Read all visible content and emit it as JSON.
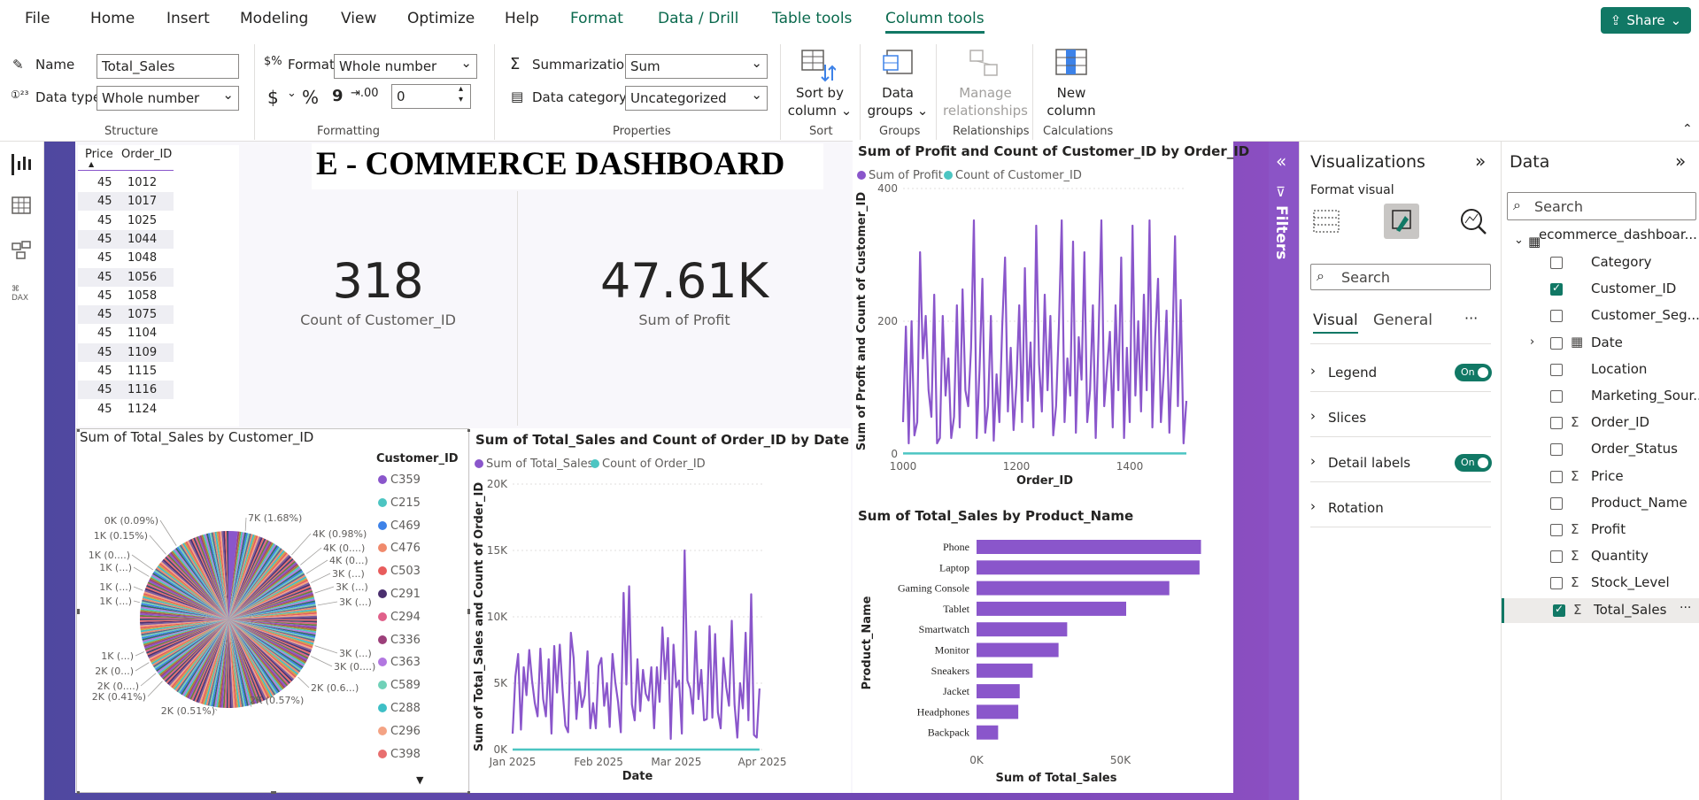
{
  "menu": {
    "items": [
      "File",
      "Home",
      "Insert",
      "Modeling",
      "View",
      "Optimize",
      "Help"
    ],
    "context_items": [
      "Format",
      "Data / Drill",
      "Table tools",
      "Column tools"
    ],
    "active": "Column tools",
    "share": "Share"
  },
  "ribbon": {
    "structure": {
      "name_label": "Name",
      "name_value": "Total_Sales",
      "datatype_label": "Data type",
      "datatype_value": "Whole number",
      "group": "Structure"
    },
    "formatting": {
      "format_label": "Format",
      "format_value": "Whole number",
      "currency": "$",
      "percent": "%",
      "comma": "9",
      "decimals_value": "0",
      "group": "Formatting"
    },
    "properties": {
      "summarization_label": "Summarization",
      "summarization_value": "Sum",
      "category_label": "Data category",
      "category_value": "Uncategorized",
      "group": "Properties"
    },
    "sort": {
      "label1": "Sort by",
      "label2": "column",
      "group": "Sort"
    },
    "groups": {
      "label1": "Data",
      "label2": "groups",
      "group": "Groups"
    },
    "relationships": {
      "label1": "Manage",
      "label2": "relationships",
      "group": "Relationships"
    },
    "calculations": {
      "label1": "New",
      "label2": "column",
      "group": "Calculations"
    }
  },
  "dashboard": {
    "title": "E - COMMERCE DASHBOARD",
    "kpi1": {
      "value": "318",
      "label": "Count of Customer_ID"
    },
    "kpi2": {
      "value": "47.61K",
      "label": "Sum of Profit"
    }
  },
  "table": {
    "headers": [
      "Price",
      "Order_ID"
    ],
    "rows": [
      [
        "45",
        "1012"
      ],
      [
        "45",
        "1017"
      ],
      [
        "45",
        "1025"
      ],
      [
        "45",
        "1044"
      ],
      [
        "45",
        "1048"
      ],
      [
        "45",
        "1056"
      ],
      [
        "45",
        "1058"
      ],
      [
        "45",
        "1075"
      ],
      [
        "45",
        "1104"
      ],
      [
        "45",
        "1109"
      ],
      [
        "45",
        "1115"
      ],
      [
        "45",
        "1116"
      ],
      [
        "45",
        "1124"
      ]
    ]
  },
  "pie_visual": {
    "title": "Sum of Total_Sales by Customer_ID",
    "legend_title": "Customer_ID",
    "legend": [
      {
        "name": "C359",
        "color": "#8a56cb"
      },
      {
        "name": "C215",
        "color": "#4cc5c2"
      },
      {
        "name": "C469",
        "color": "#3d82e8"
      },
      {
        "name": "C476",
        "color": "#f08a6c"
      },
      {
        "name": "C503",
        "color": "#e85c5c"
      },
      {
        "name": "C291",
        "color": "#4a2f6e"
      },
      {
        "name": "C294",
        "color": "#e0608a"
      },
      {
        "name": "C336",
        "color": "#9c3f7a"
      },
      {
        "name": "C363",
        "color": "#b277e0"
      },
      {
        "name": "C589",
        "color": "#70d1b8"
      },
      {
        "name": "C288",
        "color": "#3ebfc6"
      },
      {
        "name": "C296",
        "color": "#f4a384"
      },
      {
        "name": "C398",
        "color": "#e86e6e"
      }
    ],
    "labels": [
      "0K (0.09%)",
      "7K (1.68%)",
      "1K (0.15%)",
      "4K (0.98%)",
      "4K (0....)",
      "1K (0....)",
      "4K (0...)",
      "1K (...)",
      "3K (...)",
      "1K (...)",
      "3K (...)",
      "1K (...)",
      "3K (...)",
      "1K (...)",
      "3K (...)",
      "2K (0...)",
      "3K (0....)",
      "2K (0....)",
      "2K (0.6...)",
      "2K (0.41%)",
      "2K (0.57%)",
      "2K (0.51%)"
    ]
  },
  "chart_data": [
    {
      "type": "line",
      "title": "Sum of Profit and Count of Customer_ID by Order_ID",
      "xlabel": "Order_ID",
      "ylabel": "Sum of Profit and Count of Customer_ID",
      "xlim": [
        1000,
        1500
      ],
      "ylim": [
        0,
        500
      ],
      "xticks": [
        "1000",
        "1200",
        "1400"
      ],
      "yticks": [
        "0",
        "200",
        "400"
      ],
      "series": [
        {
          "name": "Sum of Profit",
          "color": "#8a56cb",
          "x_start": 1000,
          "x_step": 5,
          "values": [
            60,
            240,
            20,
            250,
            35,
            60,
            380,
            180,
            260,
            120,
            70,
            300,
            20,
            30,
            260,
            110,
            180,
            30,
            70,
            280,
            50,
            310,
            120,
            90,
            200,
            440,
            30,
            160,
            330,
            40,
            90,
            260,
            25,
            150,
            60,
            240,
            370,
            80,
            200,
            45,
            130,
            280,
            60,
            350,
            100,
            210,
            50,
            430,
            170,
            80,
            300,
            120,
            260,
            35,
            90,
            240,
            440,
            60,
            180,
            110,
            400,
            40,
            220,
            140,
            380,
            60,
            120,
            280,
            30,
            220,
            440,
            90,
            160,
            230,
            50,
            280,
            120,
            370,
            30,
            200,
            60,
            430,
            110,
            250,
            80,
            300,
            120,
            440,
            50,
            220,
            330,
            60,
            150,
            270,
            40,
            190,
            410,
            90,
            290,
            20,
            100
          ]
        },
        {
          "name": "Count of Customer_ID",
          "color": "#4cc5c2",
          "x_start": 1000,
          "x_step": 5,
          "values": [
            1,
            1,
            1,
            1,
            1,
            1,
            1,
            1,
            1,
            1,
            1,
            1,
            1,
            1,
            1,
            1,
            1,
            1,
            1,
            1,
            1,
            1,
            1,
            1,
            1,
            1,
            1,
            1,
            1,
            1,
            1,
            1,
            1,
            1,
            1,
            1,
            1,
            1,
            1,
            1,
            1,
            1,
            1,
            1,
            1,
            1,
            1,
            1,
            1,
            1,
            1,
            1,
            1,
            1,
            1,
            1,
            1,
            1,
            1,
            1,
            1,
            1,
            1,
            1,
            1,
            1,
            1,
            1,
            1,
            1,
            1,
            1,
            1,
            1,
            1,
            1,
            1,
            1,
            1,
            1,
            1,
            1,
            1,
            1,
            1,
            1,
            1,
            1,
            1,
            1,
            1,
            1,
            1,
            1,
            1,
            1,
            1,
            1,
            1,
            1,
            1
          ]
        }
      ]
    },
    {
      "type": "line",
      "title": "Sum of Total_Sales and Count of Order_ID by Date",
      "xlabel": "Date",
      "ylabel": "Sum of Total_Sales and Count of Order_ID",
      "xticks": [
        "Jan 2025",
        "Feb 2025",
        "Mar 2025",
        "Apr 2025"
      ],
      "x": [
        "2025-01-01",
        "2025-01-02",
        "2025-01-03",
        "2025-01-04",
        "2025-01-05",
        "2025-01-06",
        "2025-01-07",
        "2025-01-08",
        "2025-01-09",
        "2025-01-10",
        "2025-01-11",
        "2025-01-12",
        "2025-01-13",
        "2025-01-14",
        "2025-01-15",
        "2025-01-16",
        "2025-01-17",
        "2025-01-18",
        "2025-01-19",
        "2025-01-20",
        "2025-01-21",
        "2025-01-22",
        "2025-01-23",
        "2025-01-24",
        "2025-01-25",
        "2025-01-26",
        "2025-01-27",
        "2025-01-28",
        "2025-01-29",
        "2025-01-30",
        "2025-01-31",
        "2025-02-01",
        "2025-02-02",
        "2025-02-03",
        "2025-02-04",
        "2025-02-05",
        "2025-02-06",
        "2025-02-07",
        "2025-02-08",
        "2025-02-09",
        "2025-02-10",
        "2025-02-11",
        "2025-02-12",
        "2025-02-13",
        "2025-02-14",
        "2025-02-15",
        "2025-02-16",
        "2025-02-17",
        "2025-02-18",
        "2025-02-19",
        "2025-02-20",
        "2025-02-21",
        "2025-02-22",
        "2025-02-23",
        "2025-02-24",
        "2025-02-25",
        "2025-02-26",
        "2025-02-27",
        "2025-02-28",
        "2025-03-01",
        "2025-03-02",
        "2025-03-03",
        "2025-03-04",
        "2025-03-05",
        "2025-03-06",
        "2025-03-07",
        "2025-03-08",
        "2025-03-09",
        "2025-03-10",
        "2025-03-11",
        "2025-03-12",
        "2025-03-13",
        "2025-03-14",
        "2025-03-15",
        "2025-03-16",
        "2025-03-17",
        "2025-03-18",
        "2025-03-19",
        "2025-03-20",
        "2025-03-21",
        "2025-03-22",
        "2025-03-23",
        "2025-03-24",
        "2025-03-25",
        "2025-03-26",
        "2025-03-27",
        "2025-03-28",
        "2025-03-29",
        "2025-03-30",
        "2025-03-31"
      ],
      "ylim": [
        0,
        20000
      ],
      "yticks": [
        "0K",
        "5K",
        "10K",
        "15K",
        "20K"
      ],
      "series": [
        {
          "name": "Sum of Total_Sales",
          "color": "#8a56cb",
          "values": [
            1200,
            5500,
            7200,
            1500,
            6200,
            4100,
            7500,
            5200,
            3500,
            2500,
            7600,
            3800,
            2500,
            6800,
            1200,
            7800,
            4300,
            7900,
            4500,
            1800,
            1300,
            8800,
            6900,
            2300,
            5100,
            3200,
            4100,
            7400,
            1600,
            3500,
            1600,
            6300,
            6900,
            3300,
            5000,
            1700,
            7200,
            5100,
            3600,
            1300,
            11800,
            4900,
            12300,
            3400,
            2200,
            6800,
            2900,
            6000,
            4200,
            3700,
            6200,
            1600,
            6200,
            3600,
            9200,
            5300,
            8400,
            800,
            7900,
            4700,
            5200,
            1200,
            15000,
            5200,
            4600,
            2700,
            8900,
            3800,
            6000,
            2200,
            2300,
            9300,
            2400,
            8700,
            2800,
            1600,
            6900,
            4700,
            3300,
            9700,
            3400,
            900,
            5000,
            3100,
            8800,
            2200,
            11700,
            1100,
            900,
            4600
          ]
        },
        {
          "name": "Count of Order_ID",
          "color": "#4cc5c2",
          "values": [
            3,
            3,
            3,
            3,
            3,
            3,
            3,
            3,
            3,
            3,
            3,
            3,
            3,
            3,
            3,
            3,
            3,
            3,
            3,
            3,
            3,
            3,
            3,
            3,
            3,
            3,
            3,
            3,
            3,
            3,
            3,
            3,
            3,
            3,
            3,
            3,
            3,
            3,
            3,
            3,
            3,
            3,
            3,
            3,
            3,
            3,
            3,
            3,
            3,
            3,
            3,
            3,
            3,
            3,
            3,
            3,
            3,
            3,
            3,
            3,
            3,
            3,
            3,
            3,
            3,
            3,
            3,
            3,
            3,
            3,
            3,
            3,
            3,
            3,
            3,
            3,
            3,
            3,
            3,
            3,
            3,
            3,
            3,
            3,
            3,
            3,
            3,
            3,
            3,
            3
          ]
        }
      ]
    },
    {
      "type": "bar",
      "orientation": "horizontal",
      "title": "Sum of Total_Sales by Product_Name",
      "xlabel": "Sum of Total_Sales",
      "ylabel": "Product_Name",
      "xlim": [
        0,
        80000
      ],
      "xticks": [
        "0K",
        "50K"
      ],
      "categories": [
        "Phone",
        "Laptop",
        "Gaming Console",
        "Tablet",
        "Smartwatch",
        "Monitor",
        "Sneakers",
        "Jacket",
        "Headphones",
        "Backpack"
      ],
      "values": [
        78000,
        77500,
        67000,
        52000,
        31500,
        28500,
        19500,
        15000,
        14500,
        7500
      ],
      "color": "#8a56cb"
    }
  ],
  "filters": {
    "label": "Filters"
  },
  "viz_pane": {
    "title": "Visualizations",
    "subtitle": "Format visual",
    "search_placeholder": "Search",
    "tab_visual": "Visual",
    "tab_general": "General",
    "sections": [
      {
        "label": "Legend",
        "toggle": "On"
      },
      {
        "label": "Slices",
        "toggle": ""
      },
      {
        "label": "Detail labels",
        "toggle": "On"
      },
      {
        "label": "Rotation",
        "toggle": ""
      }
    ]
  },
  "data_pane": {
    "title": "Data",
    "search_placeholder": "Search",
    "table_name": "ecommerce_dashboar...",
    "fields": [
      {
        "name": "Category",
        "sigma": false,
        "checked": false
      },
      {
        "name": "Customer_ID",
        "sigma": false,
        "checked": true
      },
      {
        "name": "Customer_Seg...",
        "sigma": false,
        "checked": false
      },
      {
        "name": "Date",
        "sigma": false,
        "checked": false,
        "calendar": true
      },
      {
        "name": "Location",
        "sigma": false,
        "checked": false
      },
      {
        "name": "Marketing_Sour...",
        "sigma": false,
        "checked": false
      },
      {
        "name": "Order_ID",
        "sigma": true,
        "checked": false
      },
      {
        "name": "Order_Status",
        "sigma": false,
        "checked": false
      },
      {
        "name": "Price",
        "sigma": true,
        "checked": false
      },
      {
        "name": "Product_Name",
        "sigma": false,
        "checked": false
      },
      {
        "name": "Profit",
        "sigma": true,
        "checked": false
      },
      {
        "name": "Quantity",
        "sigma": true,
        "checked": false
      },
      {
        "name": "Stock_Level",
        "sigma": true,
        "checked": false
      },
      {
        "name": "Total_Sales",
        "sigma": true,
        "checked": true
      }
    ]
  }
}
